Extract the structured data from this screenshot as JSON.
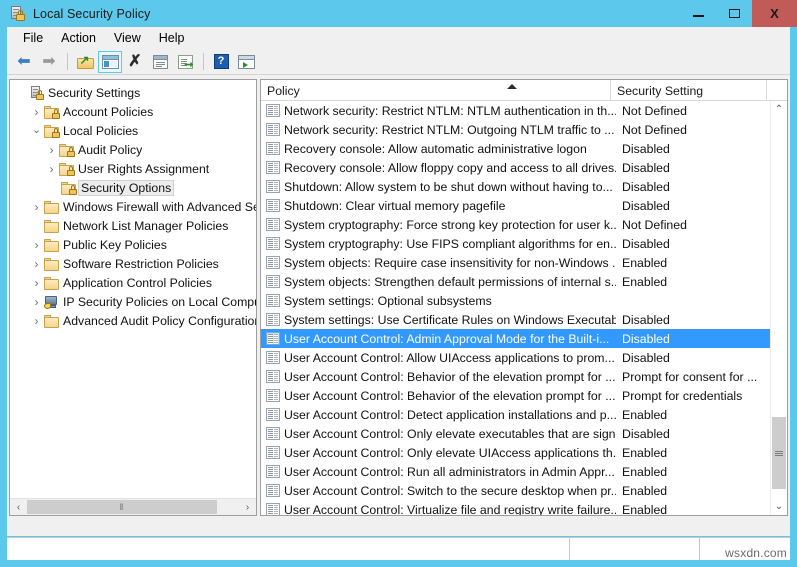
{
  "window": {
    "title": "Local Security Policy",
    "icon": "policy-lock-icon",
    "buttons": {
      "minimize": "minimize",
      "maximize": "maximize",
      "close": "X"
    },
    "accent_color": "#5BC8EC",
    "close_color": "#C05B57"
  },
  "menubar": {
    "items": [
      "File",
      "Action",
      "View",
      "Help"
    ]
  },
  "toolbar": {
    "items": [
      {
        "name": "back-icon",
        "glyph": "←"
      },
      {
        "name": "forward-icon",
        "glyph": "→"
      },
      {
        "name": "up-one-level-icon"
      },
      {
        "name": "show-hide-console-tree-icon"
      },
      {
        "name": "delete-icon",
        "glyph": "✕"
      },
      {
        "name": "properties-icon"
      },
      {
        "name": "export-list-icon"
      },
      {
        "name": "help-icon",
        "glyph": "?"
      },
      {
        "name": "show-action-pane-icon"
      }
    ]
  },
  "tree": {
    "items": [
      {
        "label": "Security Settings",
        "indent": 0,
        "twisty": "none",
        "icon": "root",
        "selected": false
      },
      {
        "label": "Account Policies",
        "indent": 1,
        "twisty": "collapsed",
        "icon": "folder-lock",
        "selected": false
      },
      {
        "label": "Local Policies",
        "indent": 1,
        "twisty": "expanded",
        "icon": "folder-lock",
        "selected": false
      },
      {
        "label": "Audit Policy",
        "indent": 2,
        "twisty": "collapsed",
        "icon": "folder-lock",
        "selected": false
      },
      {
        "label": "User Rights Assignment",
        "indent": 2,
        "twisty": "collapsed",
        "icon": "folder-lock",
        "selected": false
      },
      {
        "label": "Security Options",
        "indent": 2,
        "twisty": "none",
        "icon": "folder-lock",
        "selected": true
      },
      {
        "label": "Windows Firewall with Advanced Security",
        "indent": 1,
        "twisty": "collapsed",
        "icon": "folder",
        "selected": false
      },
      {
        "label": "Network List Manager Policies",
        "indent": 1,
        "twisty": "none",
        "icon": "folder",
        "selected": false
      },
      {
        "label": "Public Key Policies",
        "indent": 1,
        "twisty": "collapsed",
        "icon": "folder",
        "selected": false
      },
      {
        "label": "Software Restriction Policies",
        "indent": 1,
        "twisty": "collapsed",
        "icon": "folder",
        "selected": false
      },
      {
        "label": "Application Control Policies",
        "indent": 1,
        "twisty": "collapsed",
        "icon": "folder",
        "selected": false
      },
      {
        "label": "IP Security Policies on Local Computer",
        "indent": 1,
        "twisty": "collapsed",
        "icon": "computer",
        "selected": false
      },
      {
        "label": "Advanced Audit Policy Configuration",
        "indent": 1,
        "twisty": "collapsed",
        "icon": "folder",
        "selected": false
      }
    ],
    "hscroll": {
      "left_arrow": "‹",
      "right_arrow": "›",
      "grip": "‖"
    }
  },
  "list": {
    "columns": [
      {
        "label": "Policy",
        "sorted": "asc"
      },
      {
        "label": "Security Setting"
      }
    ],
    "rows": [
      {
        "policy": "Network security: Restrict NTLM: NTLM authentication in th...",
        "setting": "Not Defined",
        "selected": false
      },
      {
        "policy": "Network security: Restrict NTLM: Outgoing NTLM traffic to ...",
        "setting": "Not Defined",
        "selected": false
      },
      {
        "policy": "Recovery console: Allow automatic administrative logon",
        "setting": "Disabled",
        "selected": false
      },
      {
        "policy": "Recovery console: Allow floppy copy and access to all drives...",
        "setting": "Disabled",
        "selected": false
      },
      {
        "policy": "Shutdown: Allow system to be shut down without having to...",
        "setting": "Disabled",
        "selected": false
      },
      {
        "policy": "Shutdown: Clear virtual memory pagefile",
        "setting": "Disabled",
        "selected": false
      },
      {
        "policy": "System cryptography: Force strong key protection for user k...",
        "setting": "Not Defined",
        "selected": false
      },
      {
        "policy": "System cryptography: Use FIPS compliant algorithms for en...",
        "setting": "Disabled",
        "selected": false
      },
      {
        "policy": "System objects: Require case insensitivity for non-Windows ...",
        "setting": "Enabled",
        "selected": false
      },
      {
        "policy": "System objects: Strengthen default permissions of internal s...",
        "setting": "Enabled",
        "selected": false
      },
      {
        "policy": "System settings: Optional subsystems",
        "setting": "",
        "selected": false
      },
      {
        "policy": "System settings: Use Certificate Rules on Windows Executabl...",
        "setting": "Disabled",
        "selected": false
      },
      {
        "policy": "User Account Control: Admin Approval Mode for the Built-i...",
        "setting": "Disabled",
        "selected": true
      },
      {
        "policy": "User Account Control: Allow UIAccess applications to prom...",
        "setting": "Disabled",
        "selected": false
      },
      {
        "policy": "User Account Control: Behavior of the elevation prompt for ...",
        "setting": "Prompt for consent for ...",
        "selected": false
      },
      {
        "policy": "User Account Control: Behavior of the elevation prompt for ...",
        "setting": "Prompt for credentials",
        "selected": false
      },
      {
        "policy": "User Account Control: Detect application installations and p...",
        "setting": "Enabled",
        "selected": false
      },
      {
        "policy": "User Account Control: Only elevate executables that are sign...",
        "setting": "Disabled",
        "selected": false
      },
      {
        "policy": "User Account Control: Only elevate UIAccess applications th...",
        "setting": "Enabled",
        "selected": false
      },
      {
        "policy": "User Account Control: Run all administrators in Admin Appr...",
        "setting": "Enabled",
        "selected": false
      },
      {
        "policy": "User Account Control: Switch to the secure desktop when pr...",
        "setting": "Enabled",
        "selected": false
      },
      {
        "policy": "User Account Control: Virtualize file and registry write failure...",
        "setting": "Enabled",
        "selected": false
      }
    ],
    "selection_color": "#3399FF",
    "vscroll": {
      "up_arrow": "⌃",
      "down_arrow": "⌄"
    }
  },
  "statusbar": {
    "cells": [
      "",
      "",
      ""
    ],
    "watermark": "wsxdn.com"
  }
}
